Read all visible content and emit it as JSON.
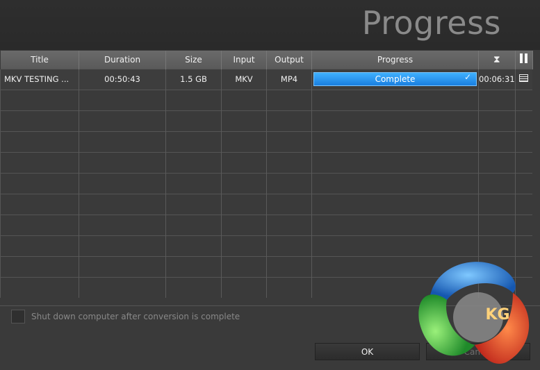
{
  "header": {
    "title": "Progress"
  },
  "table": {
    "columns": [
      "Title",
      "Duration",
      "Size",
      "Input",
      "Output",
      "Progress"
    ],
    "rows": [
      {
        "title": "MKV TESTING ...",
        "duration": "00:50:43",
        "size": "1.5 GB",
        "input": "MKV",
        "output": "MP4",
        "progress_label": "Complete",
        "progress_fraction": 1.0,
        "elapsed": "00:06:31"
      }
    ]
  },
  "options": {
    "shutdown_label": "Shut down computer after conversion is complete",
    "shutdown_checked": false
  },
  "buttons": {
    "ok": "OK",
    "cancel": "Cancel"
  },
  "watermark": {
    "text": "KG"
  },
  "colors": {
    "accent": "#1a8ff0",
    "background": "#3a3a3a"
  },
  "icons": {
    "elapsed_column": "hourglass-icon",
    "pause_column": "pause-icon",
    "row_details": "list-icon",
    "progress_done": "check-icon"
  }
}
